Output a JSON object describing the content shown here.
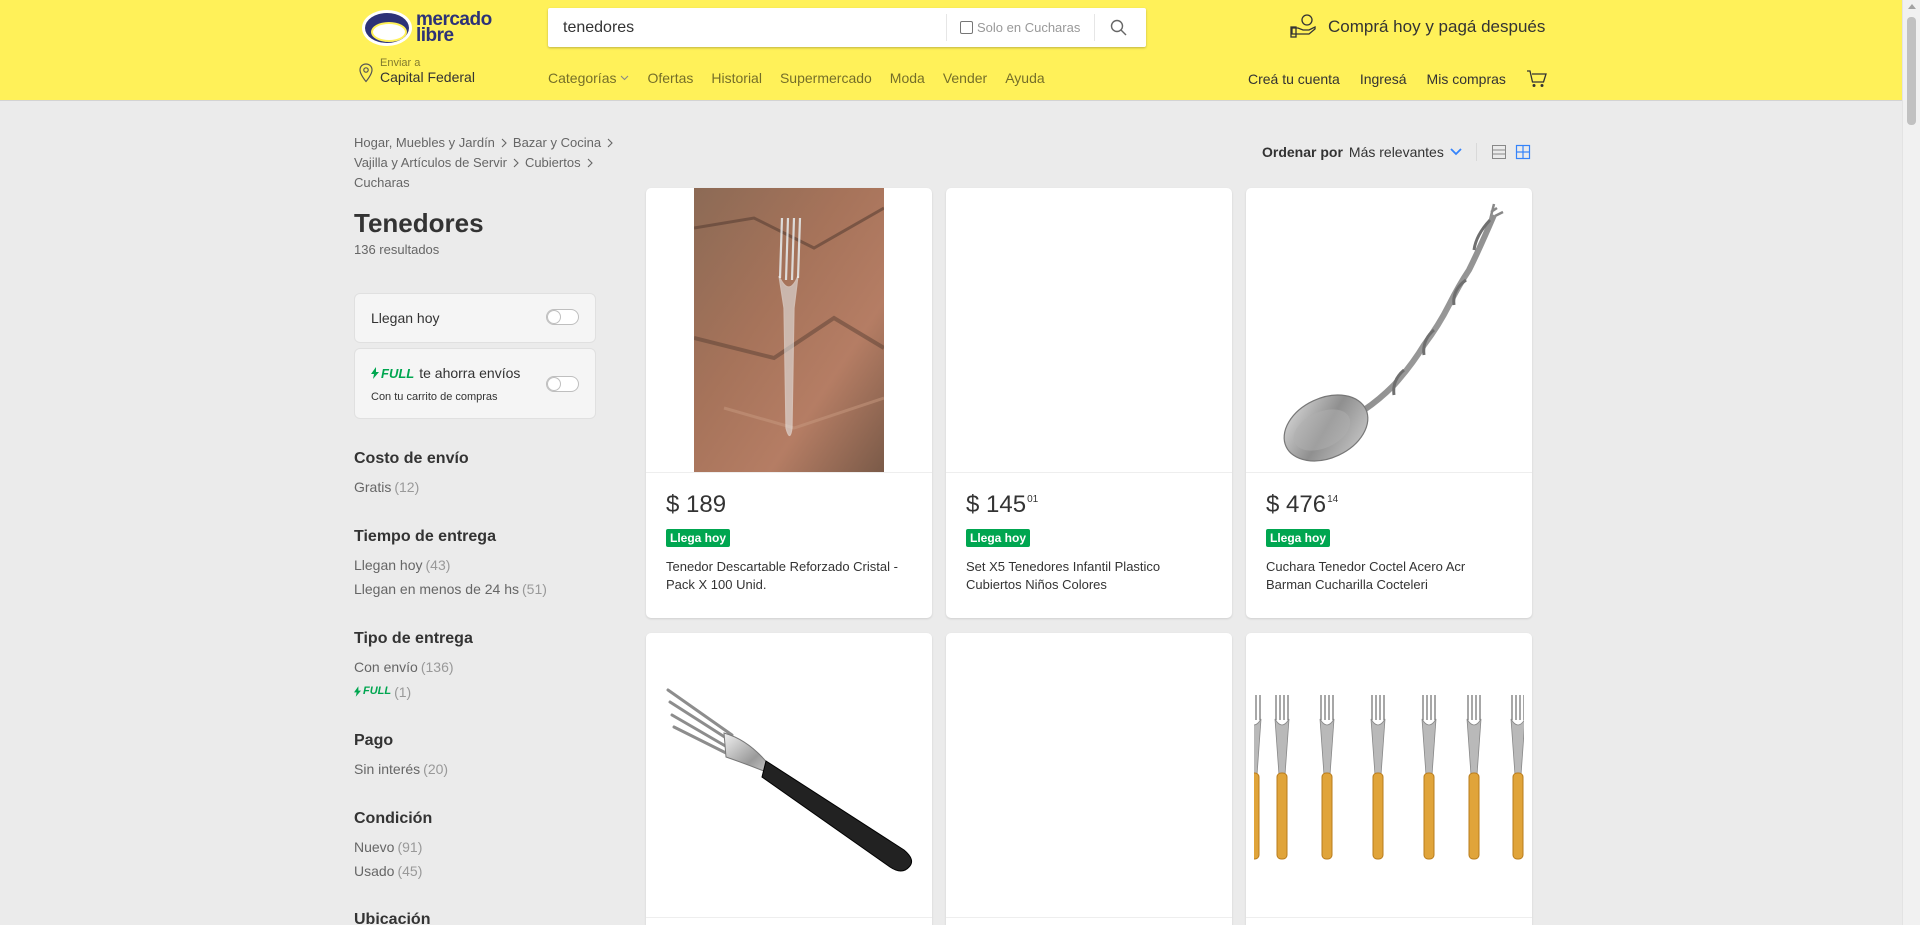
{
  "header": {
    "logo_text_1": "mercado",
    "logo_text_2": "libre",
    "search_value": "tenedores",
    "search_scope": "Solo en Cucharas",
    "promo_text": "Comprá hoy y pagá después",
    "location_small": "Enviar a",
    "location_big": "Capital Federal",
    "nav": [
      "Categorías",
      "Ofertas",
      "Historial",
      "Supermercado",
      "Moda",
      "Vender",
      "Ayuda"
    ],
    "user_nav": [
      "Creá tu cuenta",
      "Ingresá",
      "Mis compras"
    ],
    "colors": {
      "bg": "#fff159",
      "brand": "#2d3277"
    }
  },
  "breadcrumbs": [
    "Hogar, Muebles y Jardín",
    "Bazar y Cocina",
    "Vajilla y Artículos de Servir",
    "Cubiertos",
    "Cucharas"
  ],
  "page": {
    "title": "Tenedores",
    "results": "136 resultados"
  },
  "quick_filters": {
    "llegan_hoy": "Llegan hoy",
    "full_brand": "FULL",
    "full_text": "te ahorra envíos",
    "full_sub": "Con tu carrito de compras"
  },
  "facets": [
    {
      "title": "Costo de envío",
      "items": [
        {
          "label": "Gratis",
          "count": "(12)"
        }
      ]
    },
    {
      "title": "Tiempo de entrega",
      "items": [
        {
          "label": "Llegan hoy",
          "count": "(43)"
        },
        {
          "label": "Llegan en menos de 24 hs",
          "count": "(51)"
        }
      ]
    },
    {
      "title": "Tipo de entrega",
      "items": [
        {
          "label": "Con envío",
          "count": "(136)"
        },
        {
          "label": "FULL",
          "count": "(1)"
        }
      ]
    },
    {
      "title": "Pago",
      "items": [
        {
          "label": "Sin interés",
          "count": "(20)"
        }
      ]
    },
    {
      "title": "Condición",
      "items": [
        {
          "label": "Nuevo",
          "count": "(91)"
        },
        {
          "label": "Usado",
          "count": "(45)"
        }
      ]
    },
    {
      "title": "Ubicación",
      "items": []
    }
  ],
  "sort": {
    "label": "Ordenar por",
    "value": "Más relevantes"
  },
  "products": [
    {
      "price_int": "$ 189",
      "price_cents": "",
      "badge": "Llega hoy",
      "title": "Tenedor Descartable Reforzado Cristal - Pack X 100 Unid.",
      "image": "clear-plastic-fork-on-stone"
    },
    {
      "price_int": "$ 145",
      "price_cents": "01",
      "badge": "Llega hoy",
      "title": "Set X5 Tenedores Infantil Plastico Cubiertos Niños Colores",
      "image": "blank"
    },
    {
      "price_int": "$ 476",
      "price_cents": "14",
      "badge": "Llega hoy",
      "title": "Cuchara Tenedor Coctel Acero Acr Barman Cucharilla Cocteleri",
      "image": "twisted-bar-spoon"
    },
    {
      "price_int": "",
      "price_cents": "",
      "badge": "",
      "title": "",
      "image": "black-handle-fork"
    },
    {
      "price_int": "",
      "price_cents": "",
      "badge": "",
      "title": "",
      "image": "blank"
    },
    {
      "price_int": "",
      "price_cents": "",
      "badge": "",
      "title": "",
      "image": "six-yellow-handle-forks"
    }
  ],
  "accent": {
    "green": "#00a650",
    "blue": "#3483fa"
  }
}
